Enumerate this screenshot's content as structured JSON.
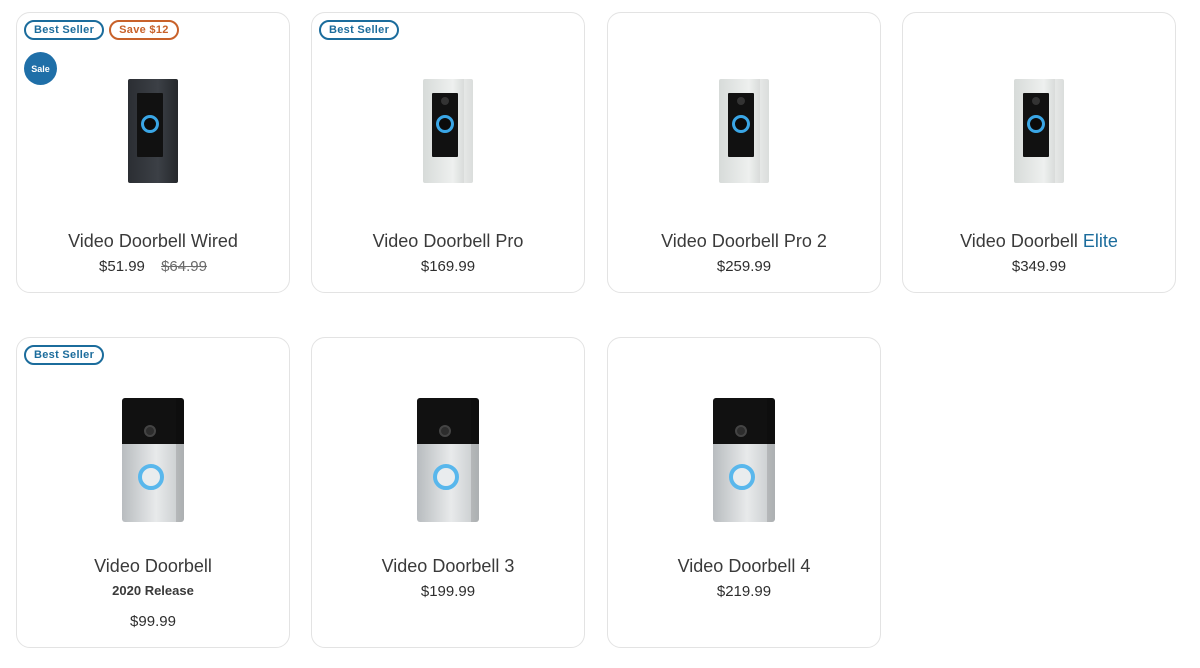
{
  "products": [
    {
      "badges": [
        "Best Seller",
        "Save $12"
      ],
      "sale": "Sale",
      "name": "Video Doorbell Wired",
      "price": "$51.99",
      "original_price": "$64.99",
      "icon": "doorbell-wired"
    },
    {
      "badges": [
        "Best Seller"
      ],
      "name": "Video Doorbell Pro",
      "price": "$169.99",
      "icon": "doorbell-pro"
    },
    {
      "badges": [],
      "name": "Video Doorbell Pro 2",
      "price": "$259.99",
      "icon": "doorbell-pro-2"
    },
    {
      "badges": [],
      "name_prefix": "Video Doorbell",
      "name_highlight": "Elite",
      "price": "$349.99",
      "icon": "doorbell-elite"
    },
    {
      "badges": [
        "Best Seller"
      ],
      "name": "Video Doorbell",
      "subtitle": "2020 Release",
      "price": "$99.99",
      "icon": "doorbell-2020"
    },
    {
      "badges": [],
      "name": "Video Doorbell 3",
      "price": "$199.99",
      "icon": "doorbell-3"
    },
    {
      "badges": [],
      "name": "Video Doorbell 4",
      "price": "$219.99",
      "icon": "doorbell-4"
    }
  ],
  "colors": {
    "badge_blue": "#1b6c9c",
    "badge_orange": "#c8612a",
    "sale_blue": "#1f6fa8",
    "ring_blue": "#3aa6e6"
  }
}
